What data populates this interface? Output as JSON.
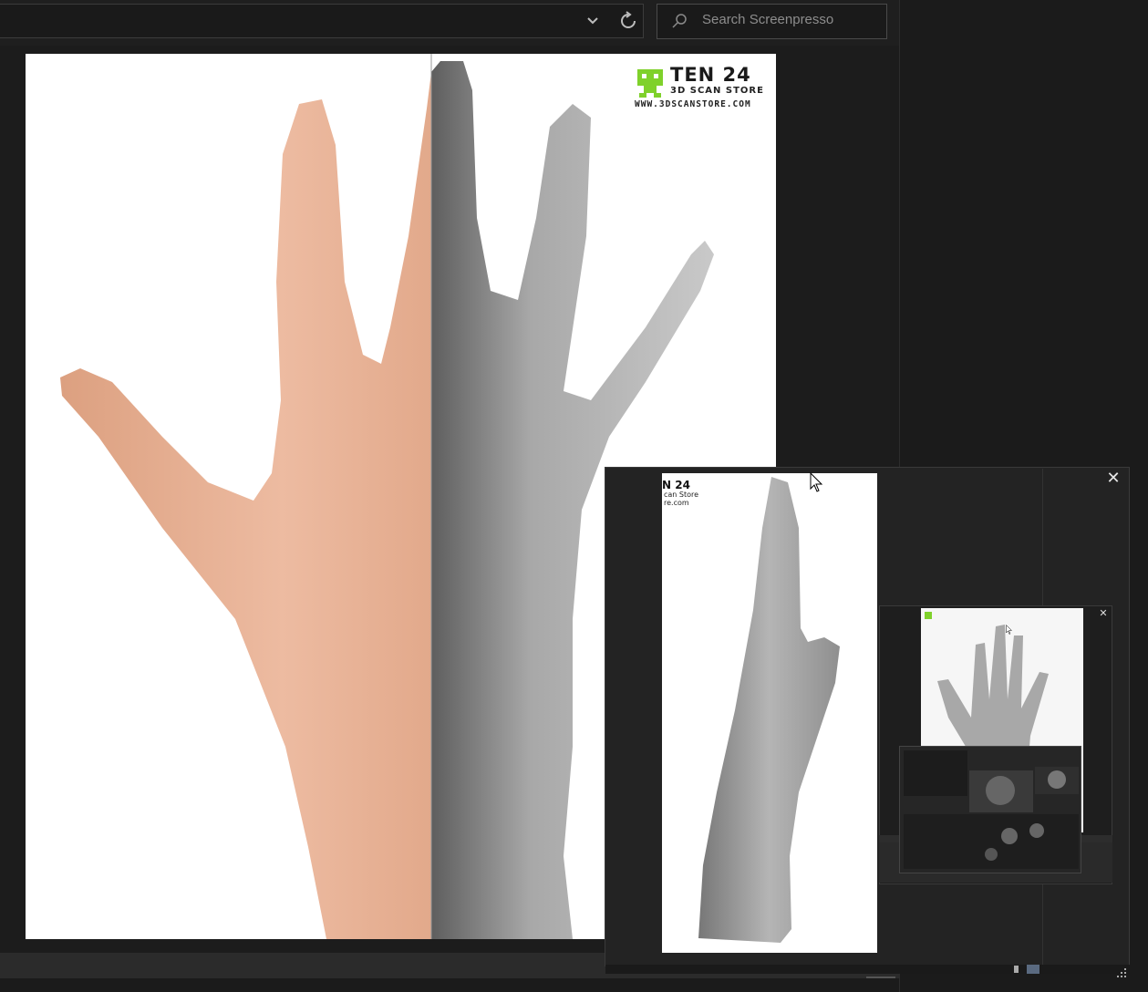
{
  "toolbar": {
    "search_placeholder": "Search Screenpresso",
    "dropdown_icon": "chevron-down-icon",
    "refresh_icon": "refresh-icon",
    "search_icon": "search-icon"
  },
  "main_image": {
    "brand_title": "TEN 24",
    "brand_subtitle": "3D SCAN STORE",
    "brand_url": "WWW.3DSCANSTORE.COM"
  },
  "preview_popup": {
    "close_label": "✕",
    "preview_logo_line1": "N 24",
    "preview_logo_line2": "can Store",
    "preview_logo_line3": "re.com",
    "nested_close_label": "✕"
  },
  "colors": {
    "background": "#1b1b1b",
    "logo_green": "#7fd12b",
    "skin": "#e8b296",
    "scan_grey": "#9a9a9a"
  }
}
